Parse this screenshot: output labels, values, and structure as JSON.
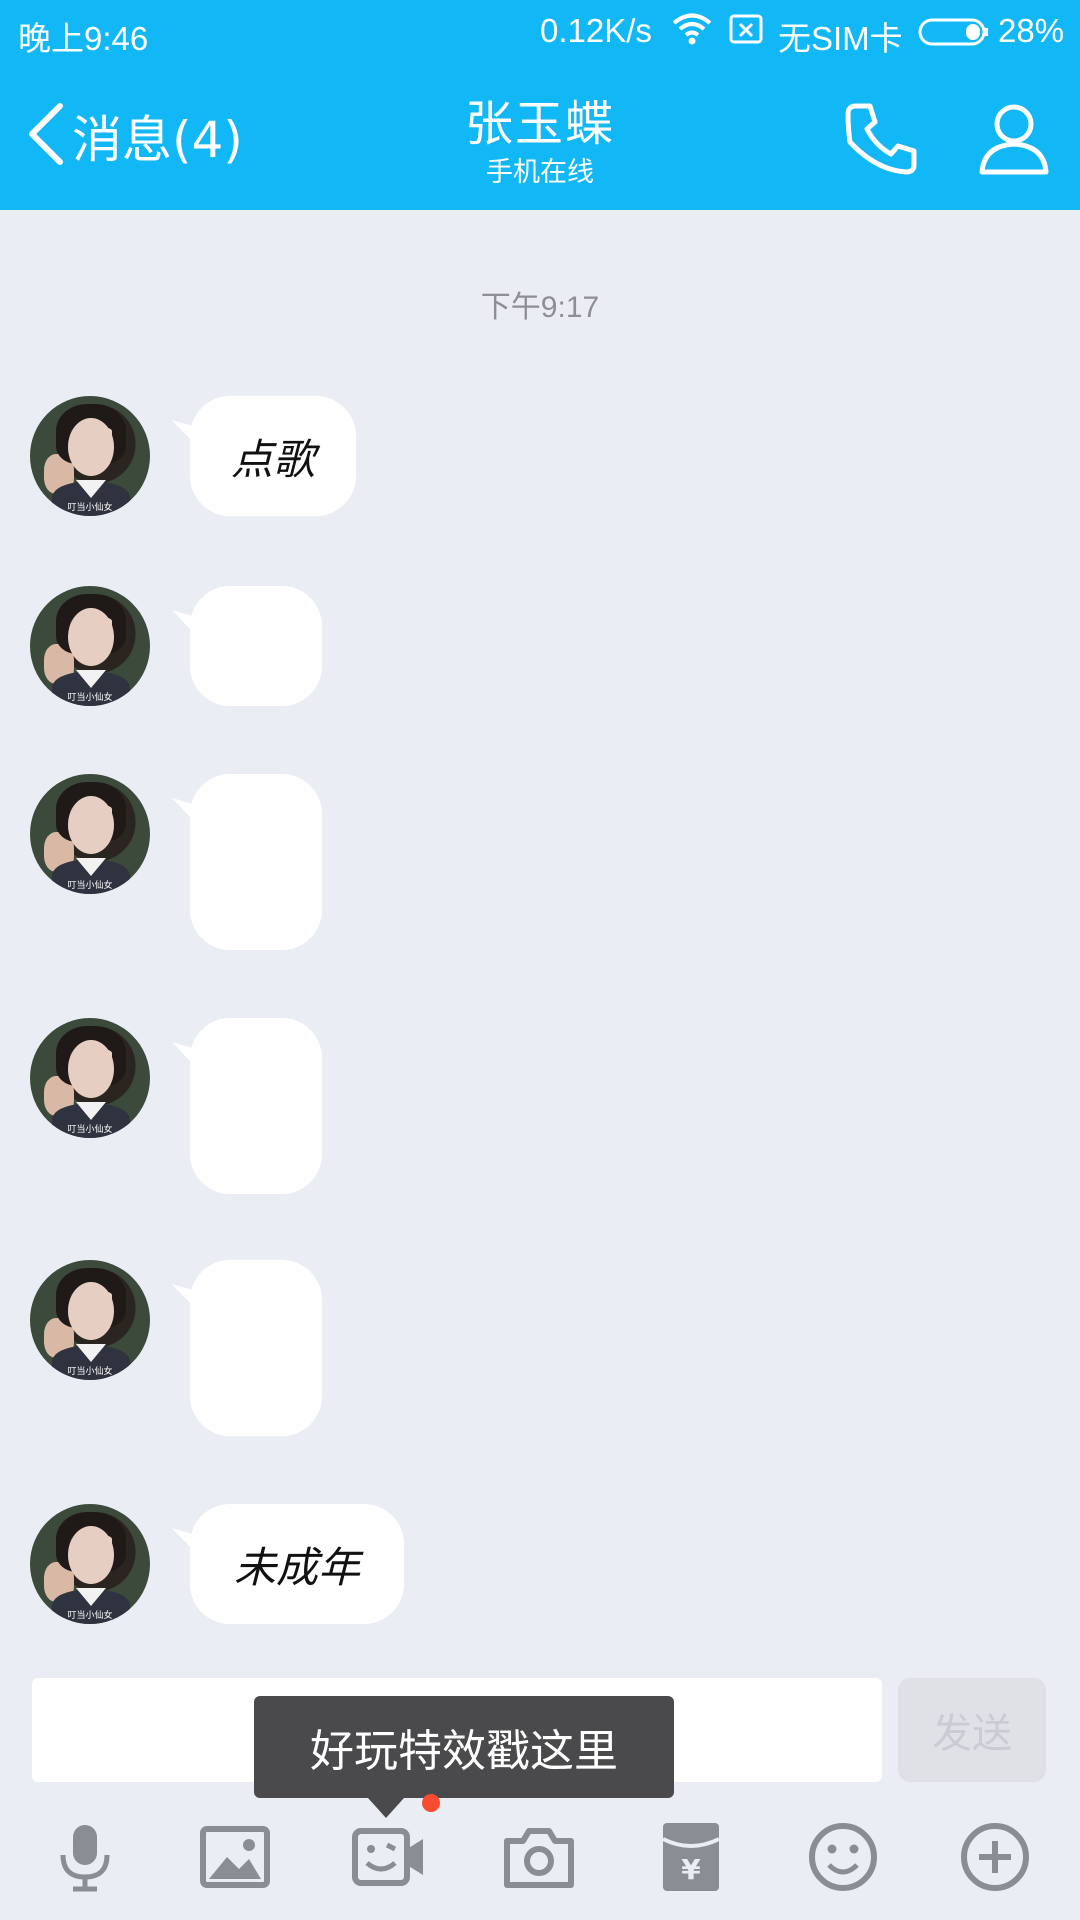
{
  "status_bar": {
    "time": "晚上9:46",
    "net_speed": "0.12K/s",
    "sim": "无SIM卡",
    "battery": "28%"
  },
  "header": {
    "back_label": "消息(4)",
    "contact_name": "张玉蝶",
    "contact_status": "手机在线",
    "icons": [
      "back-chevron",
      "phone-icon",
      "profile-icon"
    ]
  },
  "chat": {
    "timestamp": "下午9:17",
    "avatar_caption": "叮当小仙女",
    "messages": [
      {
        "sender": "contact",
        "text": "点歌"
      },
      {
        "sender": "contact",
        "text": ""
      },
      {
        "sender": "contact",
        "text": ""
      },
      {
        "sender": "contact",
        "text": ""
      },
      {
        "sender": "contact",
        "text": ""
      },
      {
        "sender": "contact",
        "text": "未成年"
      }
    ]
  },
  "composer": {
    "input_value": "",
    "send_label": "发送",
    "tooltip": "好玩特效戳这里"
  },
  "toolbar": {
    "items": [
      "microphone-icon",
      "image-icon",
      "video-effects-icon",
      "camera-icon",
      "red-packet-icon",
      "emoji-icon",
      "plus-icon"
    ]
  },
  "colors": {
    "accent": "#12b7f5",
    "chat_bg": "#ebedf5",
    "icon_gray": "#8a8d94",
    "badge": "#f74c31"
  }
}
